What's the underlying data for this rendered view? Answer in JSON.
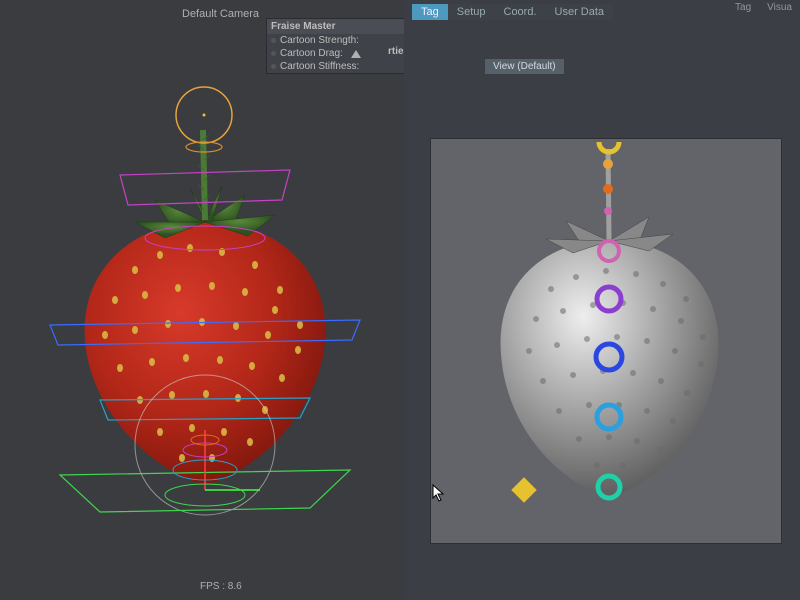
{
  "left_viewport": {
    "camera_label": "Default Camera",
    "fps_label": "FPS : 8.6"
  },
  "attribute_panel": {
    "title": "Fraise Master",
    "rows": [
      "Cartoon Strength:",
      "Cartoon Drag:",
      "Cartoon Stiffness:"
    ],
    "cropped_label": "rties"
  },
  "right_panel": {
    "top_tabs": [
      "Tag",
      "Visua"
    ],
    "tabs": [
      {
        "label": "Tag",
        "active": true
      },
      {
        "label": "Setup",
        "active": false
      },
      {
        "label": "Coord.",
        "active": false
      },
      {
        "label": "User Data",
        "active": false
      }
    ],
    "view_button": "View (Default)"
  },
  "rig_control_colors": {
    "top_ring": "#e6a23c",
    "tip_disc": "#d88f2e",
    "upper_plane": "#c542c5",
    "mid_plane": "#3b6cff",
    "lower_plane": "#2aa0c8",
    "base_plane": "#3fd84f",
    "big_circle": "#d0d0d0",
    "small_ring1": "#c542c5",
    "small_ring2": "#e36a1f",
    "small_ring3": "#e6c22e"
  },
  "clay_controls": [
    {
      "name": "top-arc",
      "color": "#e6c22e"
    },
    {
      "name": "dot-yellow",
      "color": "#e6a23c"
    },
    {
      "name": "dot-orange",
      "color": "#e36a1f"
    },
    {
      "name": "dot-pink",
      "color": "#d062b0"
    },
    {
      "name": "ring-pink",
      "color": "#d062b0"
    },
    {
      "name": "ring-purple",
      "color": "#8a3fd0"
    },
    {
      "name": "ring-blue",
      "color": "#2a48e0"
    },
    {
      "name": "ring-cyan",
      "color": "#2aa0e0"
    },
    {
      "name": "ring-teal",
      "color": "#1fd0a8"
    },
    {
      "name": "diamond-yellow",
      "color": "#e6c22e"
    }
  ]
}
